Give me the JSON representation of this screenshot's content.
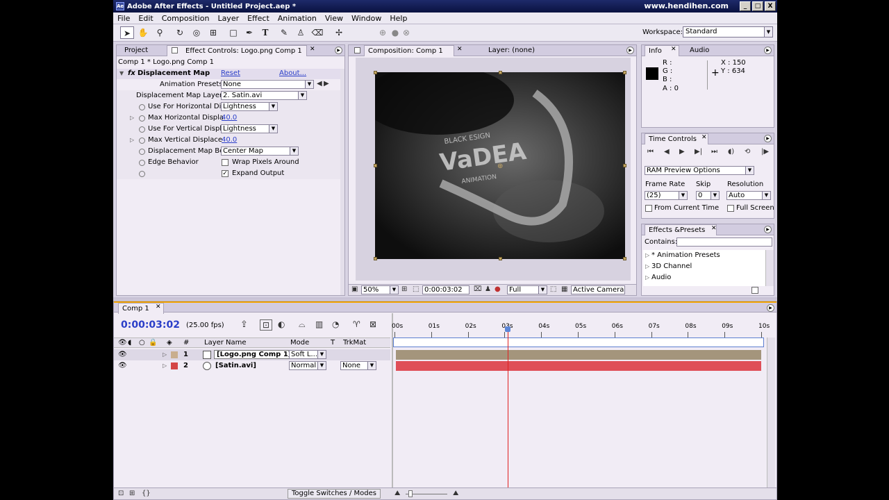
{
  "app": {
    "title": "Adobe After Effects - Untitled Project.aep *",
    "watermark": "www.hendihen.com",
    "icon_name": "ae-app-icon",
    "window_buttons": [
      "_",
      "□",
      "X"
    ]
  },
  "menu": [
    "File",
    "Edit",
    "Composition",
    "Layer",
    "Effect",
    "Animation",
    "View",
    "Window",
    "Help"
  ],
  "toolbar": {
    "workspace_label": "Workspace:",
    "workspace_value": "Standard",
    "tool_icons": [
      "selection-tool-icon",
      "hand-tool-icon",
      "zoom-tool-icon",
      "rotate-tool-icon",
      "orbit-camera-icon",
      "pan-behind-icon",
      "rectangle-mask-icon",
      "pen-tool-icon",
      "text-tool-icon",
      "brush-tool-icon",
      "clone-stamp-icon",
      "eraser-icon",
      "puppet-pin-icon"
    ]
  },
  "project_tab": "Project",
  "effect_controls": {
    "tab_label": "Effect Controls: Logo.png Comp 1",
    "breadcrumb": "Comp 1 * Logo.png Comp 1",
    "effect_name": "Displacement Map",
    "reset": "Reset",
    "about": "About...",
    "presets_label": "Animation Presets:",
    "presets_value": "None",
    "props": [
      {
        "label": "Displacement Map Layer",
        "value": "2. Satin.avi",
        "kind": "select"
      },
      {
        "label": "Use For Horizontal Dis",
        "value": "Lightness",
        "kind": "select"
      },
      {
        "label": "Max Horizontal Displa",
        "value": "40.0",
        "kind": "number"
      },
      {
        "label": "Use For Vertical Displ",
        "value": "Lightness",
        "kind": "select"
      },
      {
        "label": "Max Vertical Displace",
        "value": "40.0",
        "kind": "number"
      },
      {
        "label": "Displacement Map Be",
        "value": "Center Map",
        "kind": "select"
      },
      {
        "label": "Edge Behavior",
        "value": "Wrap Pixels Around",
        "kind": "checkbox",
        "checked": false
      },
      {
        "label": "",
        "value": "Expand Output",
        "kind": "checkbox",
        "checked": true
      }
    ]
  },
  "composition": {
    "tab_label": "Composition: Comp 1",
    "layer_tab": "Layer: (none)",
    "canvas_text_top": "BLACK ESIGN",
    "canvas_text_main": "VaDEA",
    "canvas_text_sub": "ANIMATION",
    "zoom": "50%",
    "timecode": "0:00:03:02",
    "resolution": "Full",
    "camera": "Active Camera"
  },
  "info": {
    "tab": "Info",
    "audio_tab": "Audio",
    "r": "R :",
    "g": "G :",
    "b": "B :",
    "a": "A : 0",
    "x": "X : 150",
    "y": "Y : 634"
  },
  "time_controls": {
    "tab": "Time Controls",
    "ram_preview": "RAM Preview Options",
    "frame_rate_label": "Frame Rate",
    "frame_rate_value": "(25)",
    "skip_label": "Skip",
    "skip_value": "0",
    "resolution_label": "Resolution",
    "resolution_value": "Auto",
    "from_current": "From Current Time",
    "full_screen": "Full Screen"
  },
  "effects_presets": {
    "tab": "Effects &Presets",
    "contains_label": "Contains:",
    "items": [
      "* Animation Presets",
      "3D Channel",
      "Audio"
    ]
  },
  "timeline": {
    "tab": "Comp 1",
    "timecode": "0:00:03:02",
    "fps": "(25.00 fps)",
    "col_layer_name": "Layer Name",
    "col_mode": "Mode",
    "col_t": "T",
    "col_trkmat": "TrkMat",
    "col_hash": "#",
    "ruler": [
      "00s",
      "01s",
      "02s",
      "03s",
      "04s",
      "05s",
      "06s",
      "07s",
      "08s",
      "09s",
      "10s"
    ],
    "playhead_seconds": 3.08,
    "duration_seconds": 10,
    "layers": [
      {
        "num": "1",
        "name": "[Logo.png Comp 1]",
        "mode": "Soft L...",
        "trkmat": "",
        "color": "#c9ae8e",
        "bar": "#a4957c"
      },
      {
        "num": "2",
        "name": "[Satin.avi]",
        "mode": "Normal",
        "trkmat": "None",
        "color": "#d44646",
        "bar": "#df4f58"
      }
    ],
    "toggle": "Toggle Switches / Modes"
  },
  "colors": {
    "accent": "#f2a300",
    "panel_bg": "#f1ecf5",
    "link": "#2a3ec8",
    "playhead": "#e02020"
  }
}
